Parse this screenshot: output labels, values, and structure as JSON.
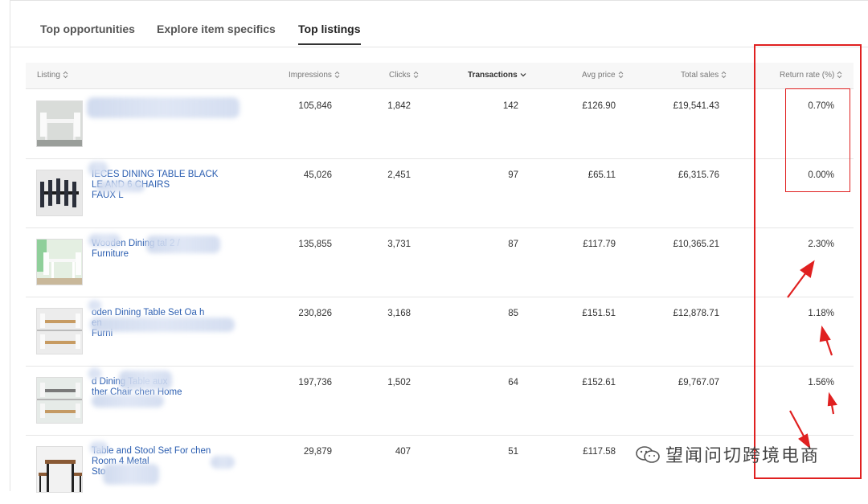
{
  "tabs": [
    {
      "label": "Top opportunities",
      "active": false
    },
    {
      "label": "Explore item specifics",
      "active": false
    },
    {
      "label": "Top listings",
      "active": true
    }
  ],
  "columns": {
    "listing": "Listing",
    "impressions": "Impressions",
    "clicks": "Clicks",
    "transactions": "Transactions",
    "avg_price": "Avg price",
    "total_sales": "Total sales",
    "return_rate": "Return rate (%)"
  },
  "rows": [
    {
      "title": "",
      "impressions": "105,846",
      "clicks": "1,842",
      "transactions": "142",
      "avg_price": "£126.90",
      "total_sales": "£19,541.43",
      "return_rate": "0.70%"
    },
    {
      "title": "IECES DINING TABLE BLACK\nLE AND 6 CHAIRS\nFAUX L",
      "impressions": "45,026",
      "clicks": "2,451",
      "transactions": "97",
      "avg_price": "£65.11",
      "total_sales": "£6,315.76",
      "return_rate": "0.00%"
    },
    {
      "title": "Wooden Dining tal 2 /\nFurniture",
      "impressions": "135,855",
      "clicks": "3,731",
      "transactions": "87",
      "avg_price": "£117.79",
      "total_sales": "£10,365.21",
      "return_rate": "2.30%"
    },
    {
      "title": "oden Dining Table Set Oa h\nen\nFurni",
      "impressions": "230,826",
      "clicks": "3,168",
      "transactions": "85",
      "avg_price": "£151.51",
      "total_sales": "£12,878.71",
      "return_rate": "1.18%"
    },
    {
      "title": "d Dining Table aux\nther Chair chen Home",
      "impressions": "197,736",
      "clicks": "1,502",
      "transactions": "64",
      "avg_price": "£152.61",
      "total_sales": "£9,767.07",
      "return_rate": "1.56%"
    },
    {
      "title": "Table and Stool Set For chen\nRoom 4 Metal\nSto",
      "impressions": "29,879",
      "clicks": "407",
      "transactions": "51",
      "avg_price": "£117.58",
      "total_sales": "",
      "return_rate": ""
    }
  ],
  "watermark": {
    "text": "望闻问切跨境电商"
  },
  "colors": {
    "link": "#2a5db0",
    "annotation": "#e02020",
    "header_bg": "#f7f7f7"
  }
}
